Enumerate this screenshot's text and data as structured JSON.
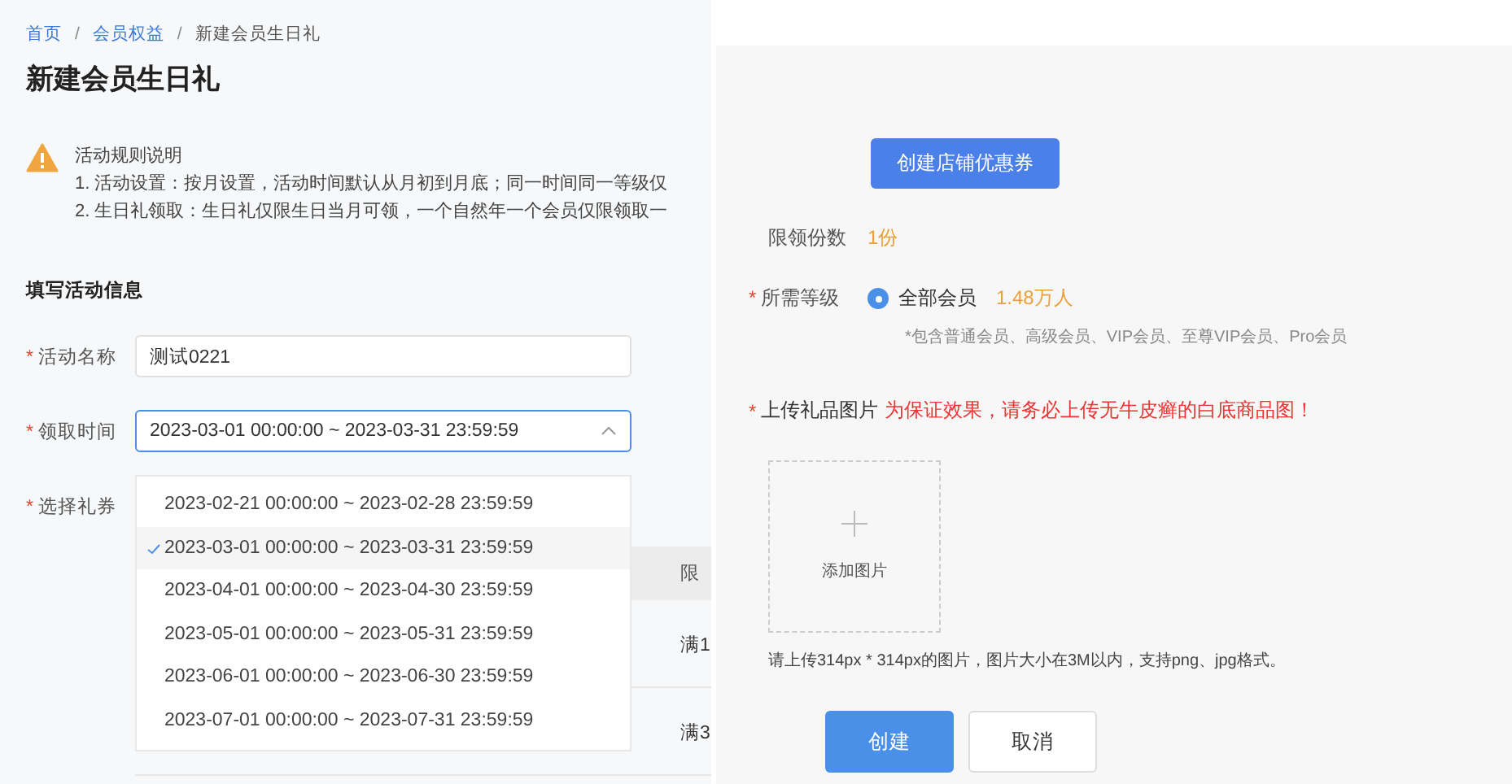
{
  "breadcrumb": [
    {
      "label": "首页",
      "kind": "link"
    },
    {
      "label": "会员权益",
      "kind": "link"
    },
    {
      "label": "新建会员生日礼",
      "kind": "current"
    }
  ],
  "separator": "/",
  "page_title": "新建会员生日礼",
  "notice": {
    "title": "活动规则说明",
    "lines": [
      "1. 活动设置：按月设置，活动时间默认从月初到月底；同一时间同一等级仅",
      "2. 生日礼领取：生日礼仅限生日当月可领，一个自然年一个会员仅限领取一"
    ]
  },
  "section_title": "填写活动信息",
  "fields": [
    {
      "mark": "*",
      "label": "活动名称",
      "value": "测试0221"
    },
    {
      "mark": "*",
      "label": "领取时间",
      "value": "2023-03-01 00:00:00 ~ 2023-03-31 23:59:59",
      "expanded": true
    },
    {
      "mark": "*",
      "label": "选择礼券"
    }
  ],
  "time_options": [
    {
      "label": "2023-02-21 00:00:00 ~ 2023-02-28 23:59:59",
      "selected": false
    },
    {
      "label": "2023-03-01 00:00:00 ~ 2023-03-31 23:59:59",
      "selected": true
    },
    {
      "label": "2023-04-01 00:00:00 ~ 2023-04-30 23:59:59",
      "selected": false
    },
    {
      "label": "2023-05-01 00:00:00 ~ 2023-05-31 23:59:59",
      "selected": false
    },
    {
      "label": "2023-06-01 00:00:00 ~ 2023-06-30 23:59:59",
      "selected": false
    },
    {
      "label": "2023-07-01 00:00:00 ~ 2023-07-31 23:59:59",
      "selected": false
    }
  ],
  "coupon_table": {
    "column_5": "限",
    "rows": [
      "满1",
      "满3"
    ]
  },
  "create_coupon_button": "创建店铺优惠券",
  "limit": {
    "label": "限领份数",
    "value": "1份"
  },
  "level": {
    "mark": "*",
    "label": "所需等级",
    "option": "全部会员",
    "selected": true,
    "count": "1.48万人",
    "note": "*包含普通会员、高级会员、VIP会员、至尊VIP会员、Pro会员"
  },
  "upload": {
    "mark": "*",
    "label": "上传礼品图片",
    "warning": "为保证效果，请务必上传无牛皮癣的白底商品图！",
    "add_label": "添加图片",
    "hint": "请上传314px * 314px的图片，图片大小在3M以内，支持png、jpg格式。"
  },
  "buttons": [
    {
      "label": "创建",
      "kind": "primary"
    },
    {
      "label": "取消",
      "kind": "default"
    }
  ]
}
